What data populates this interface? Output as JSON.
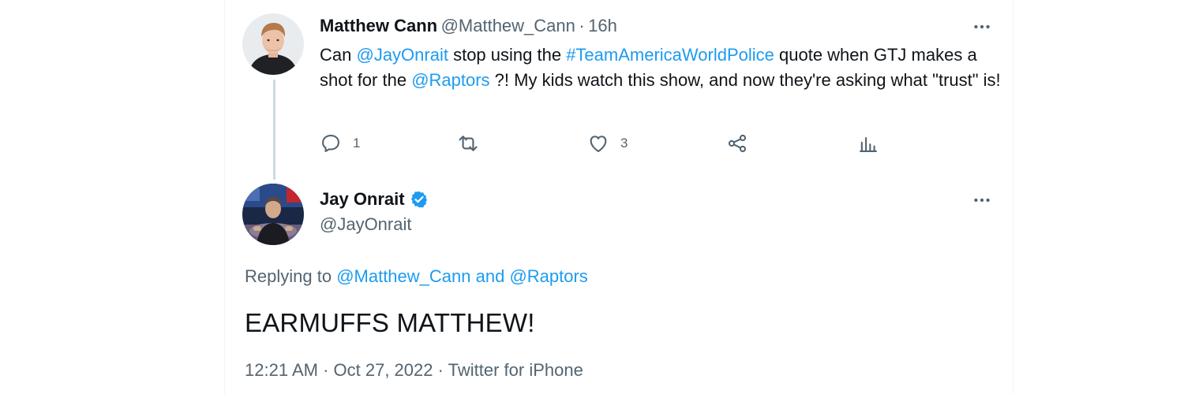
{
  "colors": {
    "text": "#0f1419",
    "muted": "#536471",
    "link": "#1d9bf0",
    "verified": "#1d9bf0",
    "thread_line": "#cfd9de",
    "border": "#eff3f4"
  },
  "tweet1": {
    "name": "Matthew Cann",
    "handle": "@Matthew_Cann",
    "separator": "·",
    "time": "16h",
    "avatar_icon": "profile-photo",
    "more_icon": "ellipsis-icon",
    "body": {
      "t1": "Can ",
      "mention1": "@JayOnrait",
      "t2": " stop using the ",
      "hashtag": "#TeamAmericaWorldPolice",
      "t3": " quote when GTJ makes a shot for the ",
      "mention2": "@Raptors",
      "t4": " ?! My kids watch this show, and now they're asking what \"trust\" is!"
    },
    "actions": {
      "reply_count": "1",
      "retweet_count": "",
      "like_count": "3",
      "share_icon": "share-icon",
      "analytics_icon": "analytics-icon"
    }
  },
  "tweet2": {
    "name": "Jay Onrait",
    "handle": "@JayOnrait",
    "verified_icon": "verified-badge-icon",
    "avatar_icon": "profile-photo",
    "more_icon": "ellipsis-icon",
    "replying_prefix": "Replying to ",
    "replying_mention1": "@Matthew_Cann",
    "replying_and": " and ",
    "replying_mention2": "@Raptors",
    "text": "EARMUFFS MATTHEW!",
    "meta": {
      "time": "12:21 AM",
      "sep1": " · ",
      "date": "Oct 27, 2022",
      "sep2": " · ",
      "source": "Twitter for iPhone"
    }
  }
}
